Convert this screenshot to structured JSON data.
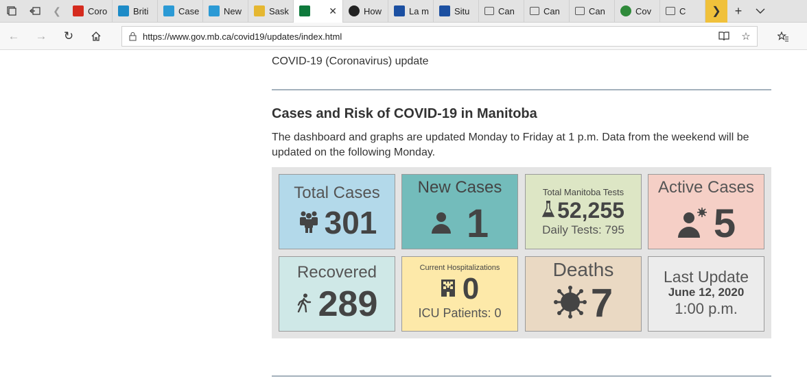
{
  "browser": {
    "tabs": [
      {
        "title": "Coro",
        "favicon": "canada-flag-icon",
        "color": "#d52b1e"
      },
      {
        "title": "Briti",
        "favicon": "bc-logo-icon",
        "color": "#1d8bc7"
      },
      {
        "title": "Case",
        "favicon": "chart-app-icon",
        "color": "#2b9ad5"
      },
      {
        "title": "New",
        "favicon": "chart-app-icon",
        "color": "#2b9ad5"
      },
      {
        "title": "Sask",
        "favicon": "sask-icon",
        "color": "#e5b731"
      },
      {
        "title": "",
        "favicon": "manitoba-icon",
        "color": "#0f7a3c",
        "active": true
      },
      {
        "title": "How",
        "favicon": "shield-icon",
        "color": "#222222"
      },
      {
        "title": "La m",
        "favicon": "quebec-icon",
        "color": "#1b4fa1"
      },
      {
        "title": "Situ",
        "favicon": "quebec-icon",
        "color": "#1b4fa1"
      },
      {
        "title": "Can",
        "favicon": "page-icon",
        "color": "#555555"
      },
      {
        "title": "Can",
        "favicon": "page-icon",
        "color": "#555555"
      },
      {
        "title": "Can",
        "favicon": "page-icon",
        "color": "#555555"
      },
      {
        "title": "Cov",
        "favicon": "globe-icon",
        "color": "#2f8a3a"
      },
      {
        "title": "C",
        "favicon": "page-icon",
        "color": "#555555"
      }
    ],
    "url": "https://www.gov.mb.ca/covid19/updates/index.html"
  },
  "page": {
    "crumb": "COVID-19 (Coronavirus) update",
    "heading": "Cases and Risk of COVID-19 in Manitoba",
    "description": "The dashboard and graphs are updated Monday to Friday at 1 p.m. Data from the weekend will be updated on the following Monday."
  },
  "dashboard": {
    "total_cases": {
      "label": "Total Cases",
      "value": "301",
      "color": "#b3d9ea"
    },
    "new_cases": {
      "label": "New Cases",
      "value": "1",
      "color": "#73bcbb"
    },
    "tests": {
      "label": "Total Manitoba Tests",
      "value": "52,255",
      "daily": "Daily Tests: 795",
      "color": "#dde6c5"
    },
    "active_cases": {
      "label": "Active Cases",
      "value": "5",
      "color": "#f5cfc6"
    },
    "recovered": {
      "label": "Recovered",
      "value": "289",
      "color": "#cfe8e7"
    },
    "hospital": {
      "label": "Current Hospitalizations",
      "value": "0",
      "icu": "ICU Patients: 0",
      "color": "#fde9a9"
    },
    "deaths": {
      "label": "Deaths",
      "value": "7",
      "color": "#ead9c3"
    },
    "last_update": {
      "label": "Last Update",
      "date": "June 12, 2020",
      "time": "1:00 p.m.",
      "color": "#ececec"
    }
  }
}
